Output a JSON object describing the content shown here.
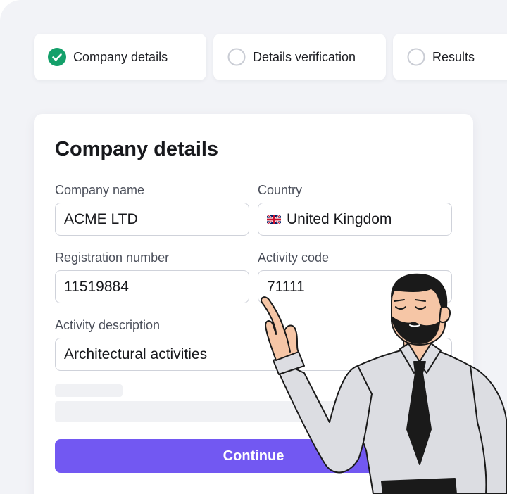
{
  "stepper": {
    "steps": [
      {
        "label": "Company details",
        "state": "completed"
      },
      {
        "label": "Details verification",
        "state": "pending"
      },
      {
        "label": "Results",
        "state": "pending"
      }
    ]
  },
  "form": {
    "title": "Company details",
    "fields": {
      "company_name": {
        "label": "Company name",
        "value": "ACME LTD"
      },
      "country": {
        "label": "Country",
        "value": "United Kingdom",
        "flag_icon": "uk-flag-icon"
      },
      "registration_number": {
        "label": "Registration number",
        "value": "11519884"
      },
      "activity_code": {
        "label": "Activity code",
        "value": "71111"
      },
      "activity_description": {
        "label": "Activity description",
        "value": "Architectural activities"
      }
    },
    "continue_label": "Continue"
  },
  "colors": {
    "accent": "#7258f2",
    "success": "#14a06a",
    "background": "#f2f3f7"
  }
}
